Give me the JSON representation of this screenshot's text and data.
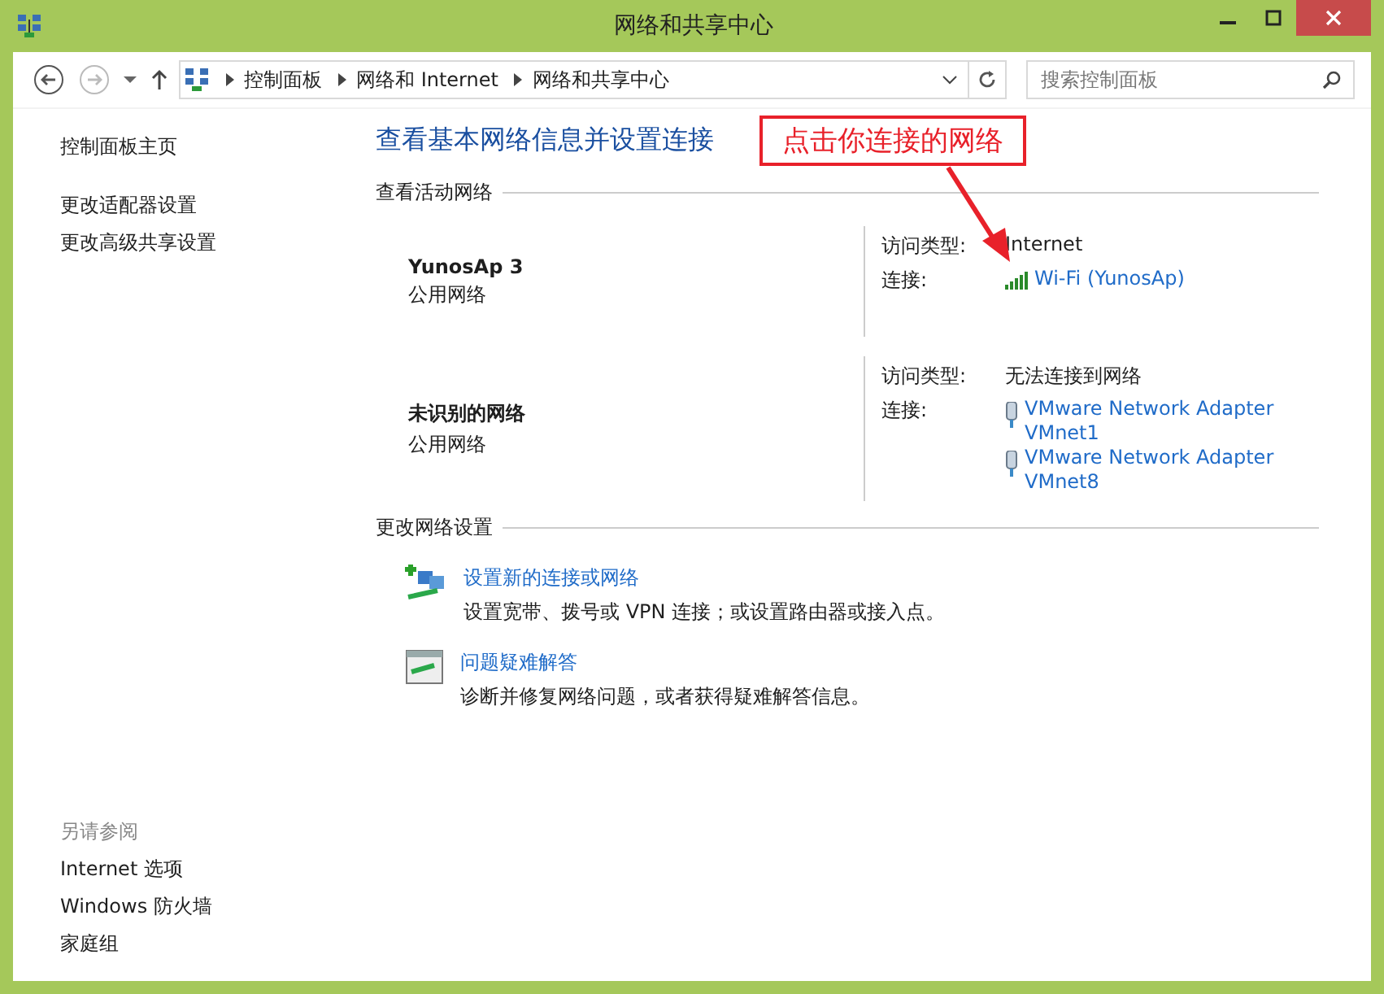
{
  "window": {
    "title": "网络和共享中心"
  },
  "address_bar": {
    "crumbs": [
      "控制面板",
      "网络和 Internet",
      "网络和共享中心"
    ]
  },
  "search": {
    "placeholder": "搜索控制面板"
  },
  "sidebar": {
    "links": [
      "控制面板主页",
      "更改适配器设置",
      "更改高级共享设置"
    ],
    "see_also_heading": "另请参阅",
    "see_also": [
      "Internet 选项",
      "Windows 防火墙",
      "家庭组"
    ]
  },
  "main": {
    "heading": "查看基本网络信息并设置连接",
    "active_title": "查看活动网络",
    "networks": [
      {
        "name": "YunosAp  3",
        "type": "公用网络",
        "access_label": "访问类型:",
        "access_value": "Internet",
        "connection_label": "连接:",
        "connections": [
          {
            "kind": "wifi",
            "label": "Wi-Fi (YunosAp)"
          }
        ]
      },
      {
        "name": "未识别的网络",
        "type": "公用网络",
        "access_label": "访问类型:",
        "access_value": "无法连接到网络",
        "connection_label": "连接:",
        "connections": [
          {
            "kind": "adapter",
            "label": "VMware Network Adapter VMnet1"
          },
          {
            "kind": "adapter",
            "label": "VMware Network Adapter VMnet8"
          }
        ]
      }
    ],
    "change_title": "更改网络设置",
    "tasks": [
      {
        "kind": "new-connection",
        "title": "设置新的连接或网络",
        "description": "设置宽带、拨号或 VPN 连接；或设置路由器或接入点。"
      },
      {
        "kind": "troubleshoot",
        "title": "问题疑难解答",
        "description": "诊断并修复网络问题，或者获得疑难解答信息。"
      }
    ]
  },
  "annotation": {
    "text": "点击你连接的网络"
  }
}
